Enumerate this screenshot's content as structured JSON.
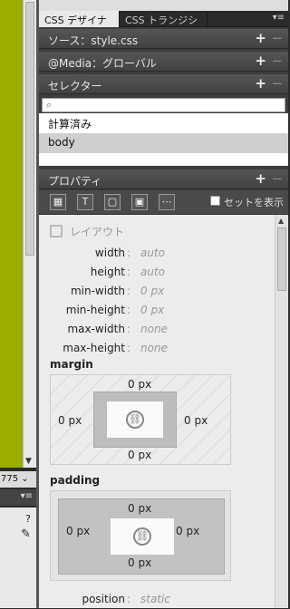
{
  "left": {
    "zoom": "775",
    "help_icon": "?"
  },
  "tabs": [
    {
      "label": "CSS デザイナー"
    },
    {
      "label": "CSS トランジション"
    }
  ],
  "sections": {
    "source": "ソース：style.css",
    "media": "@Media：グローバル",
    "selector": "セレクター",
    "properties": "プロパティ"
  },
  "selector_search": {
    "placeholder": ""
  },
  "selectors": [
    "計算済み",
    "body"
  ],
  "toolbar": {
    "show_set_label": "セットを表示"
  },
  "layout": {
    "category": "レイアウト",
    "properties": [
      {
        "name": "width",
        "value": "auto"
      },
      {
        "name": "height",
        "value": "auto"
      },
      {
        "name": "min-width",
        "value": "0 px"
      },
      {
        "name": "min-height",
        "value": "0 px"
      },
      {
        "name": "max-width",
        "value": "none"
      },
      {
        "name": "max-height",
        "value": "none"
      }
    ],
    "margin": {
      "label": "margin",
      "top": "0 px",
      "right": "0 px",
      "bottom": "0 px",
      "left": "0 px"
    },
    "padding": {
      "label": "padding",
      "top": "0 px",
      "right": "0 px",
      "bottom": "0 px",
      "left": "0 px"
    },
    "position": {
      "name": "position",
      "value": "static"
    }
  },
  "colors": {
    "accent_green": "#9aad00",
    "panel_bg": "#3d3d3d",
    "props_bg": "#ececec"
  }
}
